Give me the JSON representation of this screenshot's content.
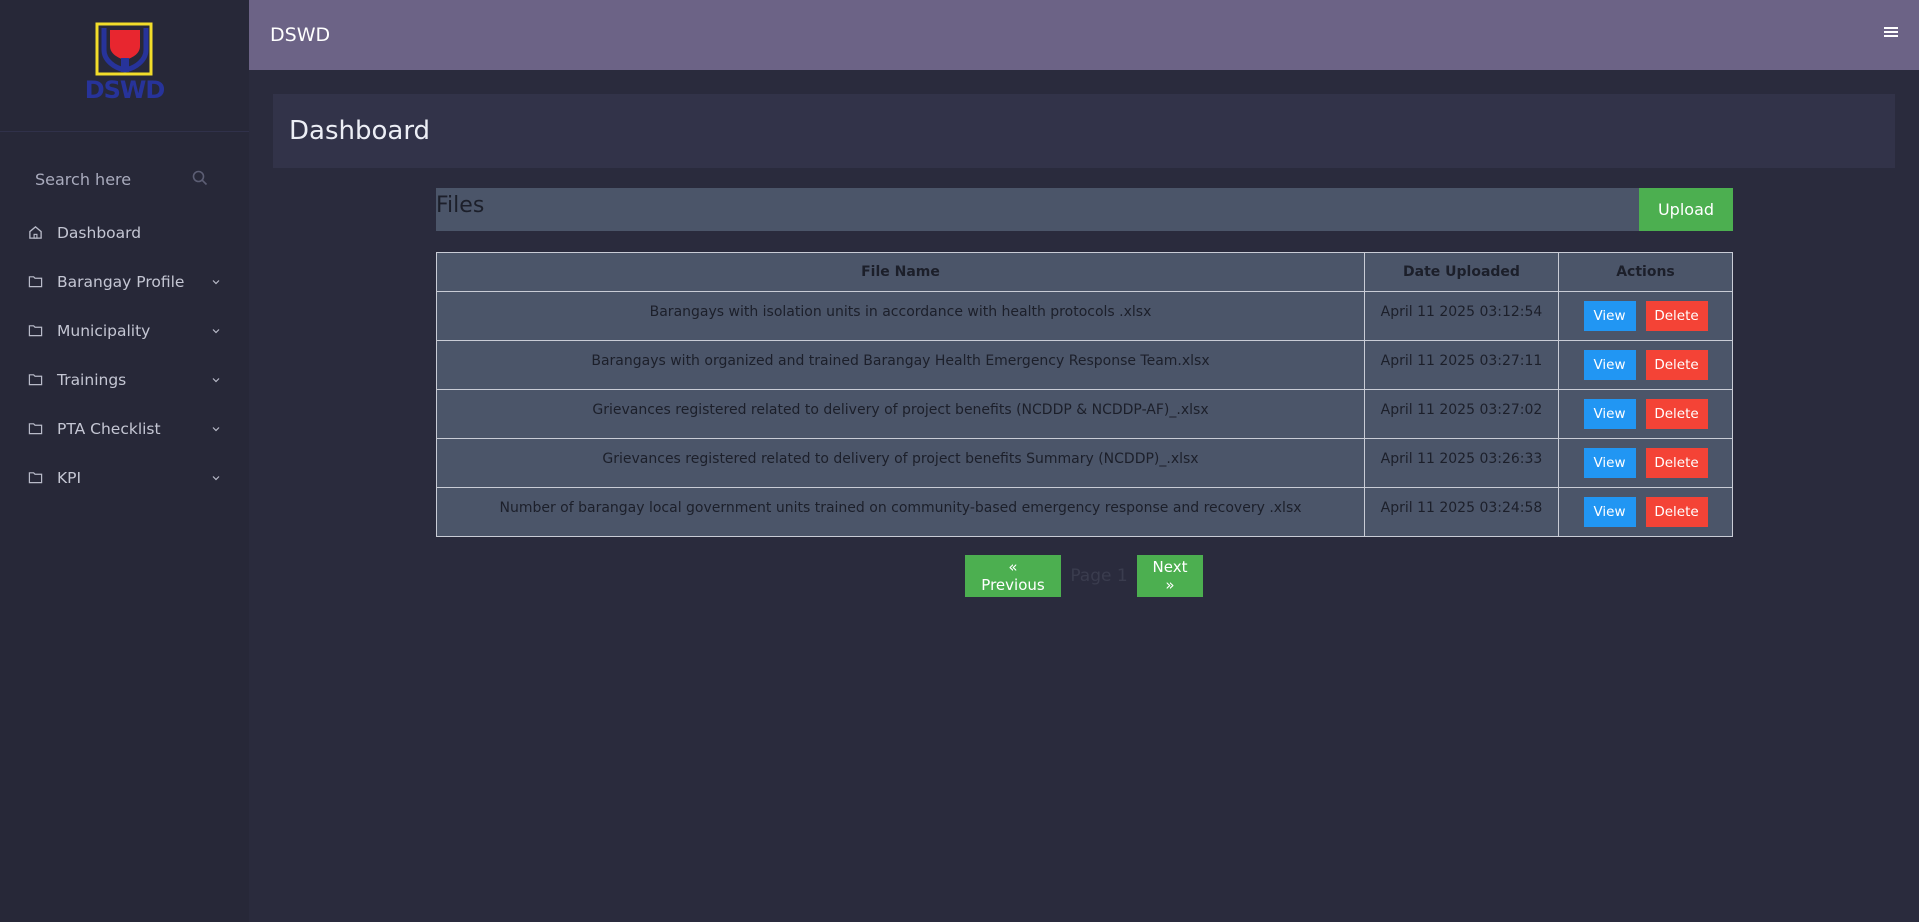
{
  "app": {
    "brand": "DSWD",
    "logo_text": "DSWD"
  },
  "colors": {
    "topbar": "#6c6386",
    "sidebar": "#272838",
    "success": "#4caf50",
    "info": "#2196f3",
    "danger": "#f44336"
  },
  "sidebar": {
    "search_placeholder": "Search here",
    "items": [
      {
        "label": "Dashboard",
        "icon": "home-icon"
      },
      {
        "label": "Barangay Profile",
        "icon": "folder-icon"
      },
      {
        "label": "Municipality",
        "icon": "folder-icon"
      },
      {
        "label": "Trainings",
        "icon": "folder-icon"
      },
      {
        "label": "PTA Checklist",
        "icon": "folder-icon"
      },
      {
        "label": "KPI",
        "icon": "folder-icon"
      }
    ]
  },
  "page": {
    "title": "Dashboard"
  },
  "files": {
    "title": "Files",
    "upload_label": "Upload",
    "columns": [
      "File Name",
      "Date Uploaded",
      "Actions"
    ],
    "rows": [
      {
        "name": "Barangays with isolation units in accordance with health protocols .xlsx",
        "date": "April 11 2025 03:12:54"
      },
      {
        "name": "Barangays with organized and trained Barangay Health Emergency Response Team.xlsx",
        "date": "April 11 2025 03:27:11"
      },
      {
        "name": "Grievances registered related to delivery of project benefits (NCDDP & NCDDP-AF)_.xlsx",
        "date": "April 11 2025 03:27:02"
      },
      {
        "name": "Grievances registered related to delivery of project benefits Summary (NCDDP)_.xlsx",
        "date": "April 11 2025 03:26:33"
      },
      {
        "name": "Number of barangay local government units trained on community-based emergency response and recovery .xlsx",
        "date": "April 11 2025 03:24:58"
      }
    ],
    "view_label": "View",
    "delete_label": "Delete"
  },
  "pager": {
    "prev_label": "« Previous",
    "info": "Page 1",
    "next_label": "Next »"
  }
}
